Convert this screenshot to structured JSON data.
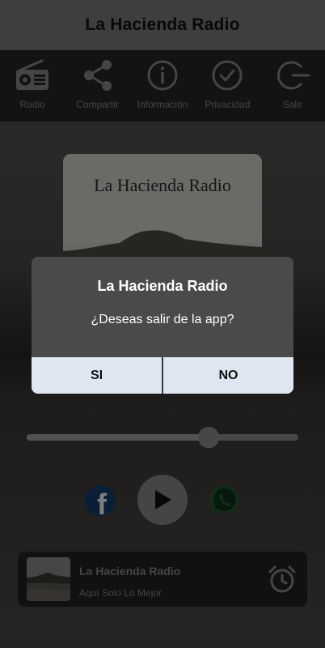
{
  "app": {
    "title": "La Hacienda Radio"
  },
  "toolbar": {
    "items": [
      {
        "label": "Radio",
        "icon": "radio-icon"
      },
      {
        "label": "Compartir",
        "icon": "share-icon"
      },
      {
        "label": "Información",
        "icon": "info-icon"
      },
      {
        "label": "Privacidad",
        "icon": "check-circle-icon"
      },
      {
        "label": "Salir",
        "icon": "exit-icon"
      }
    ]
  },
  "cover": {
    "text": "La Hacienda Radio"
  },
  "player": {
    "volume_level": 0.67,
    "facebook_icon": "facebook-icon",
    "play_icon": "play-icon",
    "whatsapp_icon": "whatsapp-icon"
  },
  "now_playing": {
    "title": "La Hacienda Radio",
    "subtitle": "Aquí Solo Lo Mejor",
    "alarm_icon": "alarm-icon"
  },
  "dialog": {
    "title": "La Hacienda Radio",
    "message": "¿Deseas salir de la app?",
    "yes_label": "SI",
    "no_label": "NO"
  },
  "colors": {
    "title_bar": "#7d7d7d",
    "toolbar": "#262626",
    "dialog_bg": "#4a4a4a",
    "dialog_button": "#dee7f1",
    "facebook": "#1877f2",
    "whatsapp": "#25d366"
  }
}
